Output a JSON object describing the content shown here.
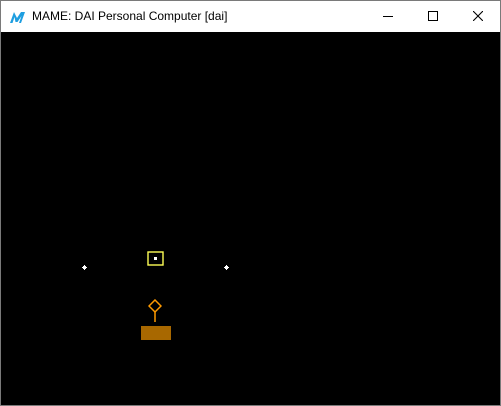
{
  "window": {
    "title": "MAME: DAI Personal Computer [dai]",
    "app_icon": "mame-logo-icon",
    "controls": [
      "minimize-icon",
      "maximize-icon",
      "close-icon"
    ]
  },
  "game": {
    "background_color": "#000000",
    "star_color": "#ffffff",
    "target_color": "#ffff55",
    "ship_color": "#ff9a00",
    "base_color": "#a86800"
  }
}
